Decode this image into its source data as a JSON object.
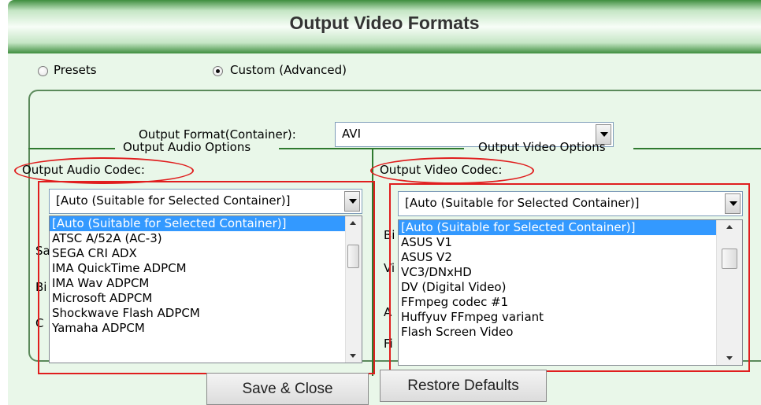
{
  "window": {
    "title": "Output Video Formats"
  },
  "mode": {
    "presets_label": "Presets",
    "custom_label": "Custom (Advanced)",
    "selected": "custom"
  },
  "container": {
    "label": "Output Format(Container):",
    "value": "AVI"
  },
  "audio": {
    "group_label": "Output Audio Options",
    "codec_label": "Output Audio Codec:",
    "combo_value": "[Auto (Suitable for Selected Container)]",
    "items": [
      "[Auto (Suitable for Selected Container)]",
      "ATSC A/52A (AC-3)",
      "SEGA CRI ADX",
      "IMA QuickTime ADPCM",
      "IMA Wav ADPCM",
      "Microsoft ADPCM",
      "Shockwave Flash ADPCM",
      "Yamaha ADPCM"
    ],
    "partial_labels": [
      "Sa",
      "Bi",
      "C"
    ]
  },
  "video": {
    "group_label": "Output Video Options",
    "codec_label": "Output Video Codec:",
    "combo_value": "[Auto (Suitable for Selected Container)]",
    "items": [
      "[Auto (Suitable for Selected Container)]",
      "ASUS V1",
      "ASUS V2",
      "VC3/DNxHD",
      "DV (Digital Video)",
      "FFmpeg codec #1",
      "Huffyuv FFmpeg variant",
      "Flash Screen Video"
    ],
    "partial_labels": [
      "Bi",
      "Vi",
      "A",
      "Fi"
    ]
  },
  "buttons": {
    "save": "Save & Close",
    "restore": "Restore Defaults"
  },
  "colors": {
    "highlight": "#3399ff",
    "annotation": "#e01e1e",
    "accent_green": "#2f7a2f"
  }
}
